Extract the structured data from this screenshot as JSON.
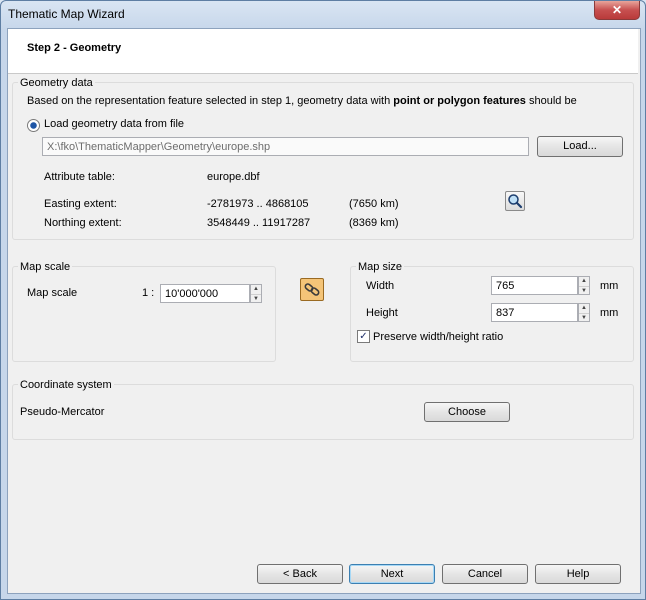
{
  "window": {
    "title": "Thematic Map Wizard",
    "close_glyph": "✕"
  },
  "header": {
    "step_title": "Step 2 - Geometry"
  },
  "geometry": {
    "group_label": "Geometry data",
    "desc_prefix": "Based on the representation feature selected in step 1, geometry data with ",
    "desc_bold": "point or polygon features",
    "desc_suffix": " should be",
    "radio_label": "Load geometry data from file",
    "file_path": "X:\\fko\\ThematicMapper\\Geometry\\europe.shp",
    "load_label": "Load...",
    "attr_label": "Attribute table:",
    "attr_value": "europe.dbf",
    "easting_label": "Easting extent:",
    "easting_value": "-2781973 .. 4868105",
    "easting_km": "(7650 km)",
    "northing_label": "Northing extent:",
    "northing_value": "3548449 .. 11917287",
    "northing_km": "(8369 km)"
  },
  "map_scale": {
    "group_label": "Map scale",
    "label": "Map scale",
    "prefix": "1 :",
    "value": "10'000'000"
  },
  "map_size": {
    "group_label": "Map size",
    "width_label": "Width",
    "width_value": "765",
    "width_unit": "mm",
    "height_label": "Height",
    "height_value": "837",
    "height_unit": "mm",
    "preserve_label": "Preserve width/height ratio",
    "preserve_checked": "✓"
  },
  "coordinate": {
    "group_label": "Coordinate system",
    "value": "Pseudo-Mercator",
    "choose_label": "Choose"
  },
  "footer": {
    "back_label": "< Back",
    "next_label": "Next",
    "cancel_label": "Cancel",
    "help_label": "Help"
  },
  "spin": {
    "up": "▲",
    "down": "▼"
  },
  "colors": {
    "link_button_bg": "#f4c478",
    "accent": "#3c7fb1"
  }
}
